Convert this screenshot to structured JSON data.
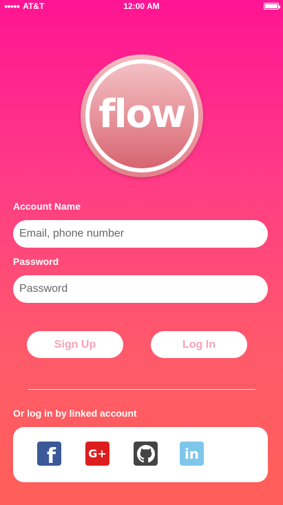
{
  "status_bar": {
    "signal": "●●●●●",
    "carrier": "AT&T",
    "time": "12:00 AM"
  },
  "logo": {
    "text": "flow"
  },
  "form": {
    "account_label": "Account Name",
    "account_placeholder": "Email, phone number",
    "password_label": "Password",
    "password_placeholder": "Password"
  },
  "buttons": {
    "sign_up": "Sign Up",
    "log_in": "Log In"
  },
  "social": {
    "label": "Or log in by linked account",
    "items": [
      {
        "name": "facebook",
        "glyph": "f",
        "color": "#3b5998"
      },
      {
        "name": "google-plus",
        "glyph": "G+",
        "color": "#dd1e1e"
      },
      {
        "name": "github",
        "glyph": "",
        "color": "#444444"
      },
      {
        "name": "linkedin",
        "glyph": "in",
        "color": "#7fc7ea"
      }
    ]
  },
  "colors": {
    "gradient_top": "#ff1493",
    "gradient_bottom": "#ff5f58",
    "button_text": "#f7a2b6"
  }
}
